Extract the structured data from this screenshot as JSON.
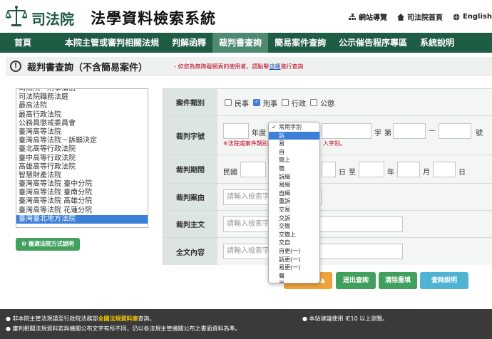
{
  "header": {
    "logo_text": "司法院",
    "site_title": "法學資料檢索系統",
    "links": [
      "網站導覽",
      "司法院首頁",
      "English"
    ]
  },
  "nav": {
    "items": [
      "首頁",
      "本院主管或審判相關法規",
      "判解函釋",
      "裁判書查詢",
      "簡易案件查詢",
      "公示催告程序專區",
      "系統說明"
    ],
    "active_index": 3
  },
  "page": {
    "title": "裁判書查詢（不含簡易案件）",
    "notice_prefix": "- 如您為無障礙網頁的使用者，請點擊",
    "notice_link": "這裡",
    "notice_suffix": "進行查詢"
  },
  "courts": {
    "items": [
      "司法院－刑事補償",
      "司法院職務法庭",
      "最高法院",
      "最高行政法院",
      "公務員懲戒委員會",
      "臺灣高等法院",
      "臺灣高等法院－訴願決定",
      "臺北高等行政法院",
      "臺中高等行政法院",
      "高雄高等行政法院",
      "智慧財產法院",
      "臺灣高等法院 臺中分院",
      "臺灣高等法院 臺南分院",
      "臺灣高等法院 高雄分院",
      "臺灣高等法院 花蓮分院",
      "臺灣臺北地方法院"
    ],
    "selected_index": 15,
    "help_button": "複選法院方式說明"
  },
  "form": {
    "case_type": {
      "label": "案件類別",
      "options": [
        {
          "label": "民事",
          "checked": false
        },
        {
          "label": "刑事",
          "checked": true
        },
        {
          "label": "行政",
          "checked": false
        },
        {
          "label": "公懲",
          "checked": false
        }
      ]
    },
    "case_number": {
      "label": "裁判字號",
      "year_label": "年度",
      "zi_label": "字",
      "di_label": "第",
      "dash": "—",
      "hao_label": "號",
      "hint_left": "※法院或案件類別",
      "hint_right": "入字別。"
    },
    "period": {
      "label": "裁判期間",
      "era": "民國",
      "day": "日",
      "to": "至",
      "year": "年",
      "month": "月"
    },
    "cause": {
      "label": "裁判案由",
      "placeholder": "請輸入檢索字"
    },
    "main_text": {
      "label": "裁判主文",
      "placeholder": "請輸入檢索字"
    },
    "full_text": {
      "label": "全文內容",
      "placeholder": "請輸入檢索字"
    }
  },
  "buttons": {
    "submit": "送出查詢",
    "clear": "清除重填",
    "help": "查詢說明"
  },
  "dropdown": {
    "options": [
      "常用字別",
      "訴",
      "易",
      "自",
      "簡上",
      "簡",
      "訴緝",
      "易緝",
      "自緝",
      "重訴",
      "交易",
      "交訴",
      "交簡",
      "交簡上",
      "交自",
      "自更(一)",
      "訴更(一)",
      "易更(一)",
      "聲",
      "再"
    ],
    "checked_index": 0,
    "highlighted_index": 1
  },
  "footer": {
    "line1_prefix": "● 非本院主管法規請至行政院法務部",
    "line1_link": "全國法規資料庫",
    "line1_suffix": "查詢。",
    "line2": "● 審判相關法規資料若與機關公布文字有所不同，仍以各法規主管機關公布之書面資料為準。",
    "line3": "● 本站建議使用 IE10 以上瀏覽。"
  },
  "colors": {
    "nav_bg": "#1f5c44",
    "nav_active": "#4e8a72",
    "submit": "#41a05e",
    "clear": "#41a05e",
    "help": "#4fb3d4",
    "orange": "#f0a23a",
    "footer_bg": "#3a3a3a"
  }
}
